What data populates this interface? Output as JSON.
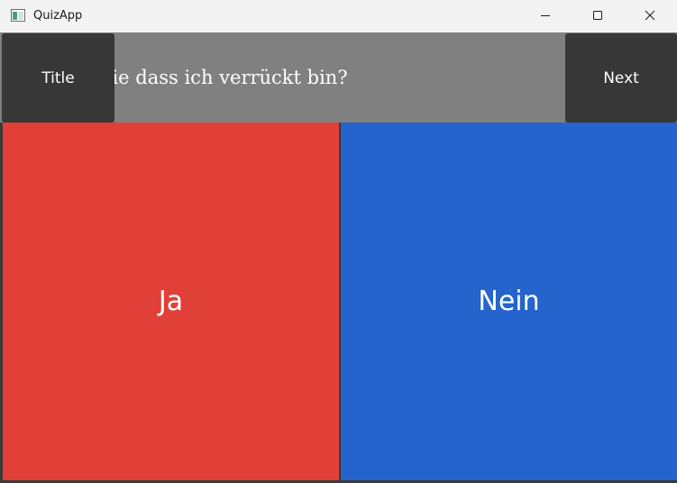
{
  "window": {
    "title": "QuizApp"
  },
  "toolbar": {
    "title_button": "Title",
    "next_button": "Next"
  },
  "question": {
    "text": "ben Sie dass ich verrückt bin?"
  },
  "answers": {
    "yes": "Ja",
    "no": "Nein"
  },
  "colors": {
    "question_bar": "#808080",
    "side_buttons": "#373737",
    "yes_answer": "#e04038",
    "no_answer": "#2464cc"
  },
  "icons": {
    "app": "app-window-icon",
    "minimize": "minimize-icon",
    "maximize": "maximize-icon",
    "close": "close-icon"
  }
}
